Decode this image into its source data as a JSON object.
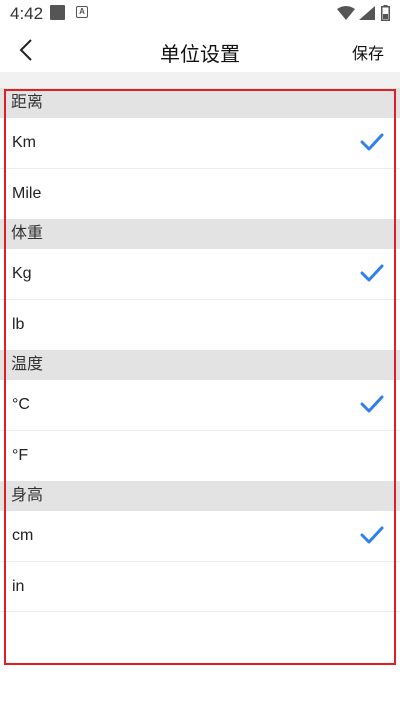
{
  "status_bar": {
    "time": "4:42"
  },
  "header": {
    "title": "单位设置",
    "save_label": "保存"
  },
  "sections": [
    {
      "title": "距离",
      "options": [
        {
          "label": "Km",
          "selected": true
        },
        {
          "label": "Mile",
          "selected": false
        }
      ]
    },
    {
      "title": "体重",
      "options": [
        {
          "label": "Kg",
          "selected": true
        },
        {
          "label": "lb",
          "selected": false
        }
      ]
    },
    {
      "title": "温度",
      "options": [
        {
          "label": "°C",
          "selected": true
        },
        {
          "label": "°F",
          "selected": false
        }
      ]
    },
    {
      "title": "身高",
      "options": [
        {
          "label": "cm",
          "selected": true
        },
        {
          "label": "in",
          "selected": false
        }
      ]
    }
  ],
  "colors": {
    "accent": "#2f7ff0",
    "section_bg": "#e3e3e3",
    "highlight": "#e02020"
  }
}
